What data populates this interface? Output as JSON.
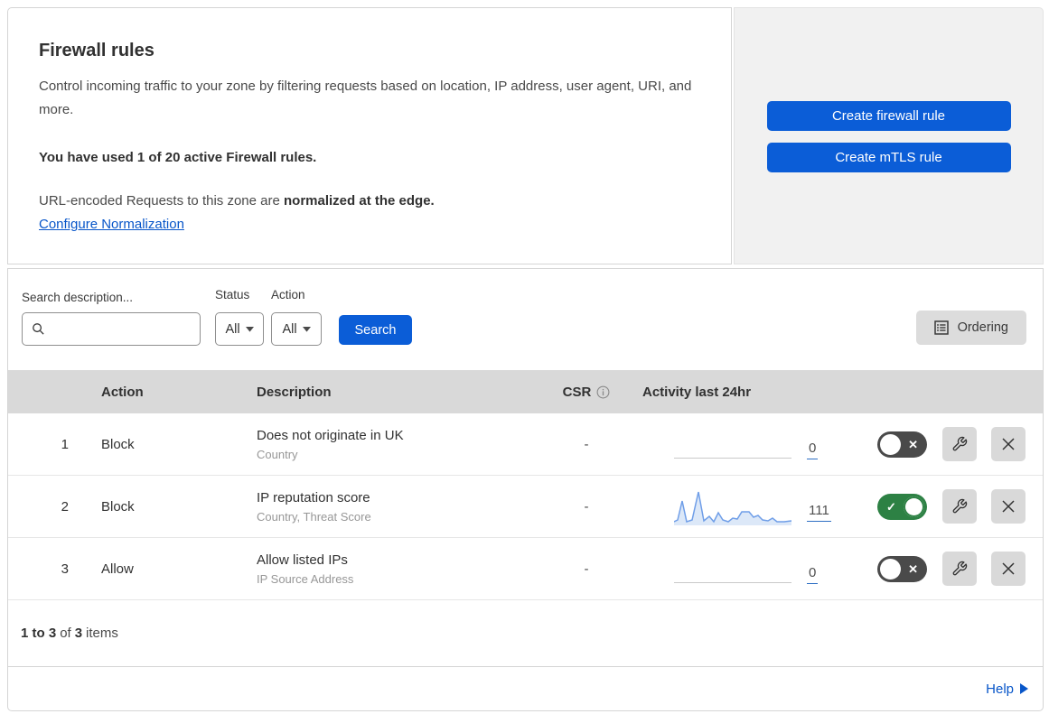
{
  "colors": {
    "accent_blue": "#0b5dd7",
    "link_blue": "#0856c9",
    "toggle_on_green": "#2d8144",
    "toggle_off_gray": "#4a4a4a",
    "table_header_bg": "#d9d9d9",
    "side_panel_bg": "#f1f1f1",
    "sparkline_stroke": "#6f9ee8",
    "sparkline_fill": "#dce8f8"
  },
  "header": {
    "title": "Firewall rules",
    "description": "Control incoming traffic to your zone by filtering requests based on location, IP address, user agent, URI, and more.",
    "usage": "You have used 1 of 20 active Firewall rules.",
    "normalization_text": "URL-encoded Requests to this zone are ",
    "normalization_bold": "normalized at the edge.",
    "normalization_link": "Configure Normalization",
    "create_firewall_button": "Create firewall rule",
    "create_mtls_button": "Create mTLS rule"
  },
  "filters": {
    "search_label": "Search description...",
    "search_placeholder": "",
    "status_label": "Status",
    "status_value": "All",
    "action_label": "Action",
    "action_value": "All",
    "search_button": "Search",
    "ordering_button": "Ordering"
  },
  "table": {
    "headers": {
      "action": "Action",
      "description": "Description",
      "csr": "CSR",
      "activity": "Activity last 24hr"
    },
    "rows": [
      {
        "num": "1",
        "action": "Block",
        "description": "Does not originate in UK",
        "fields": "Country",
        "csr": "-",
        "activity": "0",
        "enabled": false,
        "sparkline": null
      },
      {
        "num": "2",
        "action": "Block",
        "description": "IP reputation score",
        "fields": "Country, Threat Score",
        "csr": "-",
        "activity": "111",
        "enabled": true,
        "sparkline": "0,36 4,34 9,13 14,36 20,34 27,3 33,35 39,30 44,36 49,26 54,34 60,36 65,32 70,33 75,25 83,25 88,31 93,29 98,34 104,35 109,32 114,36 122,36 130,35"
      },
      {
        "num": "3",
        "action": "Allow",
        "description": "Allow listed IPs",
        "fields": "IP Source Address",
        "csr": "-",
        "activity": "0",
        "enabled": false,
        "sparkline": null
      }
    ]
  },
  "footer": {
    "range_bold": "1 to 3",
    "of_label": "of",
    "total_bold": "3",
    "items_label": "items",
    "help_label": "Help"
  }
}
